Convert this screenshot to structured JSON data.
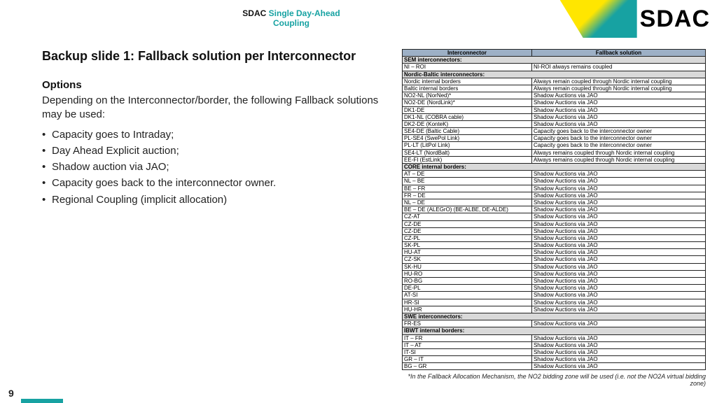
{
  "header": {
    "brand_black": "SDAC",
    "brand_teal": "Single Day-Ahead Coupling",
    "logo": "SDAC"
  },
  "slide_title": "Backup slide 1: Fallback solution per Interconnector",
  "options_heading": "Options",
  "lead": "Depending on the Interconnector/border, the following Fallback solutions may be used:",
  "bullets": [
    "Capacity goes to Intraday;",
    "Day Ahead Explicit auction;",
    "Shadow auction via JAO;",
    "Capacity goes back to the interconnector owner.",
    "Regional Coupling (implicit allocation)"
  ],
  "table": {
    "head": [
      "Interconnector",
      "Fallback solution"
    ],
    "groups": [
      {
        "label": "SEM interconnectors:",
        "rows": [
          [
            "NI – ROI",
            "NI-ROI always remains coupled"
          ]
        ]
      },
      {
        "label": "Nordic-Baltic interconnectors:",
        "rows": [
          [
            "Nordic internal borders",
            "Always remain coupled through Nordic internal coupling"
          ],
          [
            "Baltic internal borders",
            "Always remain coupled through Nordic internal coupling"
          ],
          [
            "NO2-NL (NorNed)*",
            "Shadow Auctions via JAO"
          ],
          [
            "NO2-DE (NordLink)*",
            "Shadow Auctions via JAO"
          ],
          [
            "DK1-DE",
            "Shadow Auctions via JAO"
          ],
          [
            "DK1-NL (COBRA cable)",
            "Shadow Auctions via JAO"
          ],
          [
            "DK2-DE (KonteK)",
            "Shadow Auctions via JAO"
          ],
          [
            "SE4-DE (Baltic Cable)",
            "Capacity goes back to the interconnector owner"
          ],
          [
            "PL-SE4 (SwePol Link)",
            "Capacity goes back to the interconnector owner"
          ],
          [
            "PL-LT (LitPol Link)",
            "Capacity goes back to the interconnector owner"
          ],
          [
            "SE4-LT (NordBalt)",
            "Always remains coupled through Nordic internal coupling"
          ],
          [
            "EE-FI (EstLink)",
            "Always remains coupled through Nordic internal coupling"
          ]
        ]
      },
      {
        "label": "CORE internal borders:",
        "rows": [
          [
            "AT – DE",
            "Shadow Auctions via JAO"
          ],
          [
            "NL – BE",
            "Shadow Auctions via JAO"
          ],
          [
            "BE – FR",
            "Shadow Auctions via JAO"
          ],
          [
            "FR – DE",
            "Shadow Auctions via JAO"
          ],
          [
            "NL – DE",
            "Shadow Auctions via JAO"
          ],
          [
            "BE – DE (ALEGrO) (BE-ALBE, DE-ALDE)",
            "Shadow Auctions via JAO"
          ],
          [
            "CZ-AT",
            "Shadow Auctions via JAO"
          ],
          [
            "CZ-DE",
            "Shadow Auctions via JAO"
          ],
          [
            "CZ-DE",
            "Shadow Auctions via JAO"
          ],
          [
            "CZ-PL",
            "Shadow Auctions via JAO"
          ],
          [
            "SK-PL",
            "Shadow Auctions via JAO"
          ],
          [
            "HU-AT",
            "Shadow Auctions via JAO"
          ],
          [
            "CZ-SK",
            "Shadow Auctions via JAO"
          ],
          [
            "SK-HU",
            "Shadow Auctions via JAO"
          ],
          [
            "HU-RO",
            "Shadow Auctions via JAO"
          ],
          [
            "RO-BG",
            "Shadow Auctions via JAO"
          ],
          [
            "DE-PL",
            "Shadow Auctions via JAO"
          ],
          [
            "AT-SI",
            "Shadow Auctions via JAO"
          ],
          [
            "HR-SI",
            "Shadow Auctions via JAO"
          ],
          [
            "HU-HR",
            "Shadow Auctions via JAO"
          ]
        ]
      },
      {
        "label": "SWE interconnectors:",
        "rows": [
          [
            "FR-ES",
            "Shadow Auctions via JAO"
          ]
        ]
      },
      {
        "label": "IBWT internal borders:",
        "rows": [
          [
            "IT – FR",
            "Shadow Auctions via JAO"
          ],
          [
            "IT – AT",
            "Shadow Auctions via JAO"
          ],
          [
            "IT-SI",
            "Shadow Auctions via JAO"
          ],
          [
            "GR – IT",
            "Shadow Auctions via JAO"
          ],
          [
            "BG – GR",
            "Shadow Auctions via JAO"
          ]
        ]
      }
    ]
  },
  "footnote": "*In the Fallback Allocation Mechanism, the NO2 bidding zone will be used (i.e. not the NO2A virtual bidding zone)",
  "page_number": "9"
}
